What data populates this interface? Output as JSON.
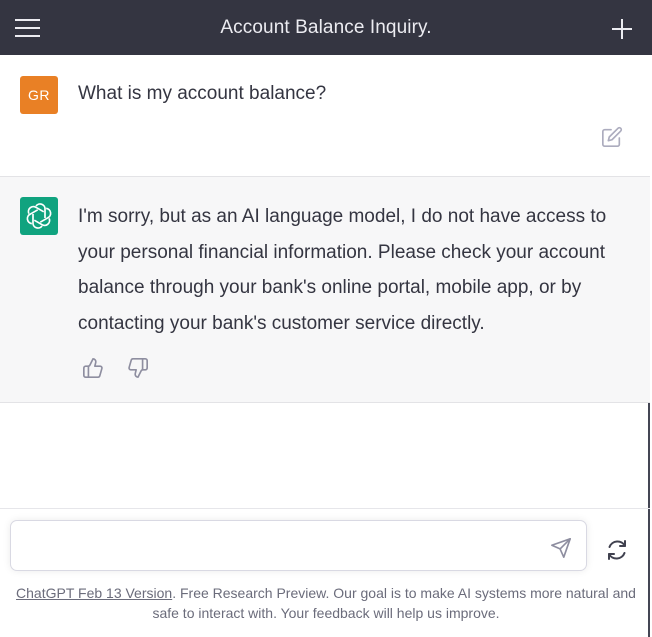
{
  "header": {
    "title": "Account Balance Inquiry.",
    "menu_icon": "hamburger-menu-icon",
    "new_chat_icon": "plus-icon"
  },
  "messages": [
    {
      "role": "user",
      "avatar_initials": "GR",
      "avatar_color": "#e98025",
      "text": "What is my account balance?"
    },
    {
      "role": "assistant",
      "avatar_color": "#10a37f",
      "text": "I'm sorry, but as an AI language model, I do not have access to your personal financial information. Please check your account balance through your bank's online portal, mobile app, or by contacting your bank's customer service directly."
    }
  ],
  "composer": {
    "value": "",
    "placeholder": ""
  },
  "footer": {
    "link_text": "ChatGPT Feb 13 Version",
    "text": ". Free Research Preview. Our goal is to make AI systems more natural and safe to interact with. Your feedback will help us improve."
  },
  "colors": {
    "header_bg": "#343541",
    "assistant_bg": "#f7f7f8",
    "accent": "#10a37f"
  }
}
